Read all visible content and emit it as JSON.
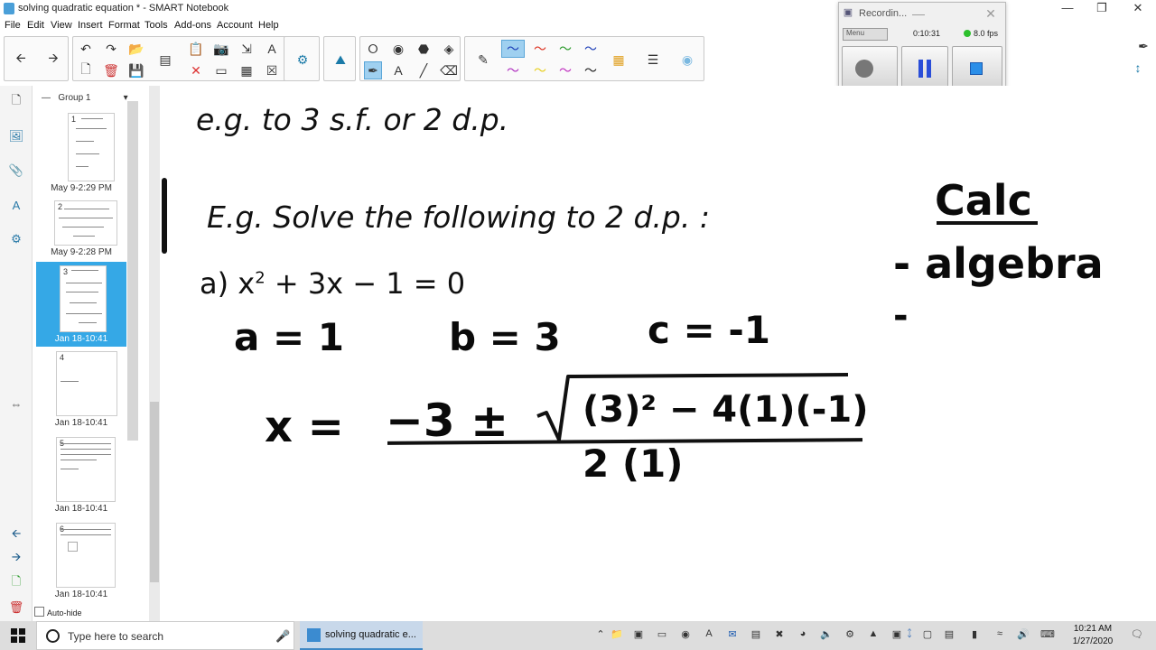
{
  "window": {
    "title": "solving quadratic equation * - SMART Notebook"
  },
  "menu": [
    "File",
    "Edit",
    "View",
    "Insert",
    "Format",
    "Tools",
    "Add-ons",
    "Account",
    "Help"
  ],
  "recorder": {
    "title": "Recordin...",
    "menu_label": "Menu",
    "elapsed": "0:10:31",
    "fps": "8.0 fps"
  },
  "sorter": {
    "group_label": "Group 1",
    "pages": [
      {
        "num": "1",
        "label": "May 9-2:29 PM"
      },
      {
        "num": "2",
        "label": "May 9-2:28 PM"
      },
      {
        "num": "3",
        "label": "Jan 18-10:41"
      },
      {
        "num": "4",
        "label": "Jan 18-10:41"
      },
      {
        "num": "5",
        "label": "Jan 18-10:41"
      },
      {
        "num": "6",
        "label": "Jan 18-10:41"
      }
    ],
    "autohide_label": "Auto-hide"
  },
  "canvas": {
    "line1": "e.g. to 3 s.f. or 2 d.p.",
    "line2": "E.g.  Solve the following to 2 d.p. :",
    "eq_prefix": "a)  x",
    "eq_exp": "2",
    "eq_rest": " + 3x  − 1  =  0",
    "coef_a": "a = 1",
    "coef_b": "b = 3",
    "coef_c": "c = -1",
    "formula_lhs": "x =",
    "formula_num_left": "−3 ±",
    "formula_radicand": "(3)² − 4(1)(-1)",
    "formula_den": "2 (1)",
    "side_title": "Calc",
    "side_item1": "- algebra",
    "side_item2": "-"
  },
  "taskbar": {
    "search_placeholder": "Type here to search",
    "active_app": "solving quadratic e...",
    "time": "10:21 AM",
    "date": "1/27/2020"
  }
}
